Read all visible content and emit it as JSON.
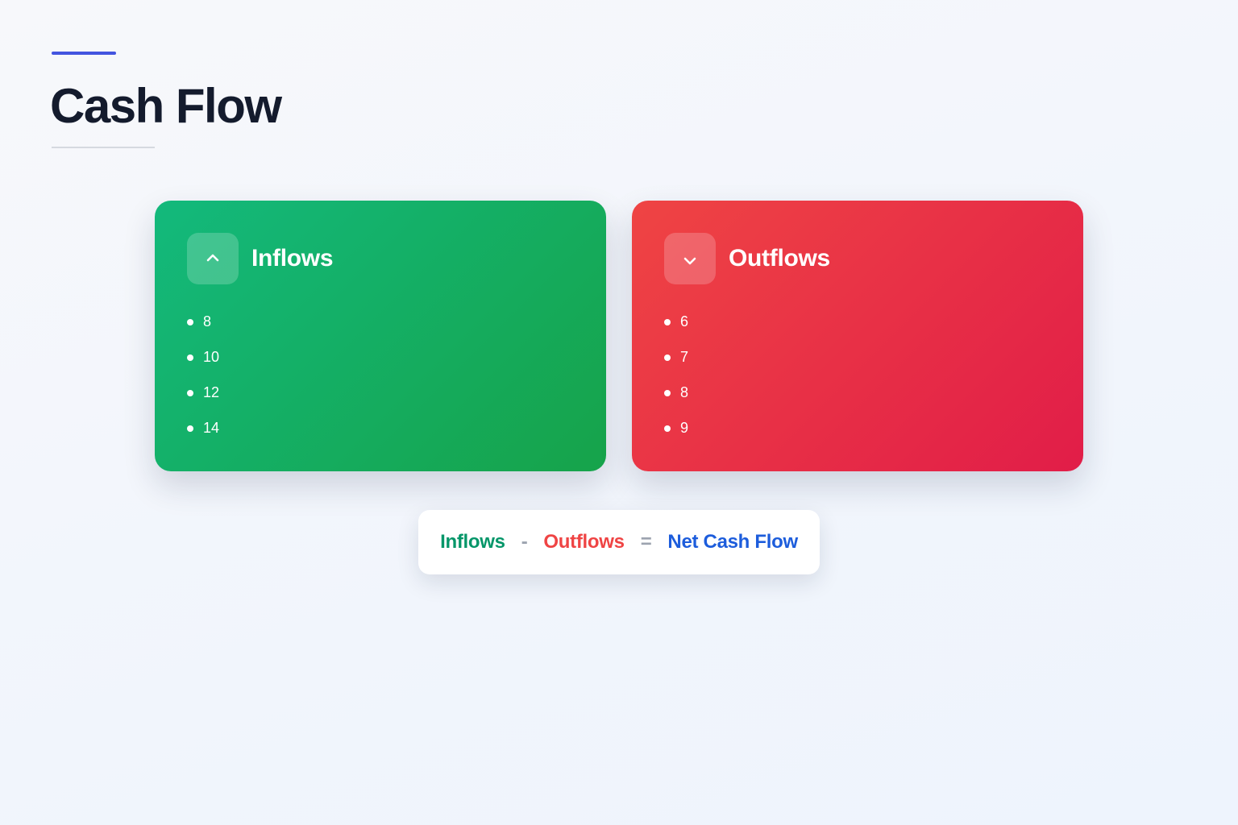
{
  "page": {
    "title": "Cash Flow"
  },
  "inflows": {
    "title": "Inflows",
    "icon": "chevron-up-icon",
    "color": "#16a34a",
    "items": [
      "8",
      "10",
      "12",
      "14"
    ]
  },
  "outflows": {
    "title": "Outflows",
    "icon": "chevron-down-icon",
    "color": "#e11d48",
    "items": [
      "6",
      "7",
      "8",
      "9"
    ]
  },
  "formula": {
    "term1": "Inflows",
    "op1": "-",
    "term2": "Outflows",
    "op2": "=",
    "result": "Net Cash Flow",
    "colors": {
      "inflows": "#059669",
      "outflows": "#ef4444",
      "result": "#1d5ddc",
      "operator": "#9ca3af"
    }
  }
}
